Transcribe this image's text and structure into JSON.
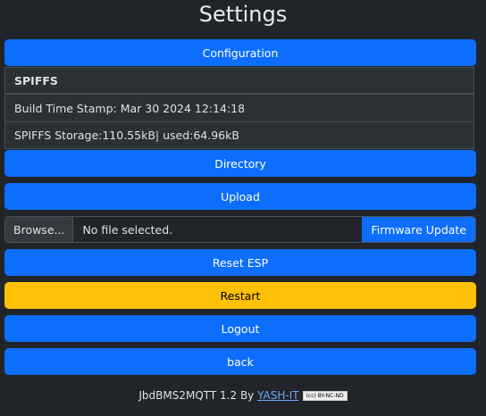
{
  "page": {
    "title": "Settings"
  },
  "buttons": {
    "configuration": "Configuration",
    "directory": "Directory",
    "upload": "Upload",
    "reset": "Reset ESP",
    "restart": "Restart",
    "logout": "Logout",
    "back": "back"
  },
  "spiffs": {
    "header": "SPIFFS",
    "build": "Build Time Stamp: Mar 30 2024 12:14:18",
    "storage": "SPIFFS Storage:110.55kB| used:64.96kB"
  },
  "file": {
    "browse": "Browse...",
    "status": "No file selected.",
    "submit": "Firmware Update"
  },
  "footer": {
    "text": "JbdBMS2MQTT 1.2 By ",
    "link": "YASH-IT",
    "license": "(cc) BY-NC-ND"
  }
}
